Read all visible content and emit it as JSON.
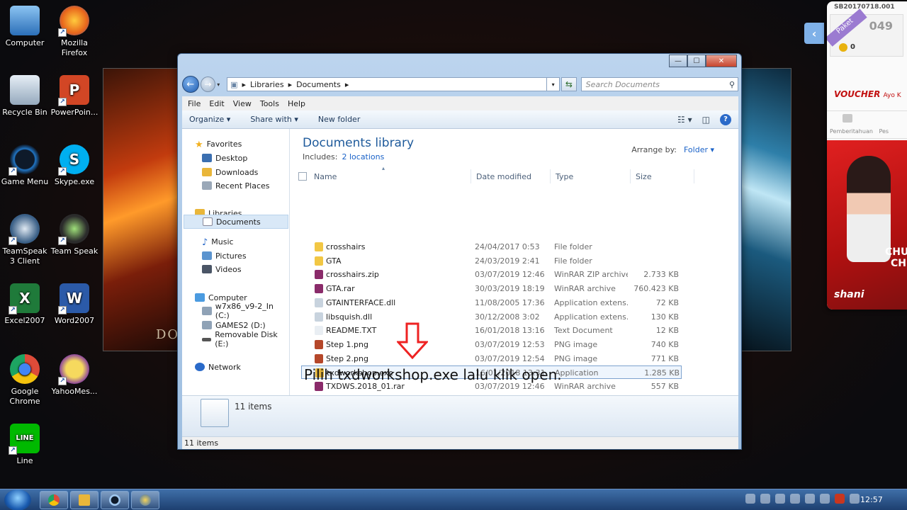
{
  "desktop": {
    "icons": [
      {
        "label": "Computer",
        "color": "#4b9be0"
      },
      {
        "label": "Mozilla Firefox",
        "color": "#e8661c"
      },
      {
        "label": "Recycle Bin",
        "color": "#9fb3c8"
      },
      {
        "label": "PowerPoin...",
        "color": "#d24625"
      },
      {
        "label": "Game Menu",
        "color": "#2176c6"
      },
      {
        "label": "Skype.exe",
        "color": "#00aff0"
      },
      {
        "label": "TeamSpeak 3 Client",
        "color": "#3a5f86"
      },
      {
        "label": "Team Speak",
        "color": "#2b2b2b"
      },
      {
        "label": "Excel2007",
        "color": "#1f7a3a"
      },
      {
        "label": "Word2007",
        "color": "#2b5aa8"
      },
      {
        "label": "Google Chrome",
        "color": "#dd4b39"
      },
      {
        "label": "YahooMes...",
        "color": "#7b2fa5"
      },
      {
        "label": "Line",
        "color": "#00b900"
      }
    ],
    "icon_glyphs": {
      "chrome": "●",
      "line": "LINE",
      "skype": "S",
      "excel": "X",
      "word": "W",
      "ppt": "P"
    },
    "wallpaper_text": "DO"
  },
  "window": {
    "address": {
      "root": "Libraries",
      "current": "Documents"
    },
    "search_placeholder": "Search Documents",
    "menu": [
      "File",
      "Edit",
      "View",
      "Tools",
      "Help"
    ],
    "toolbar": {
      "organize": "Organize ▾",
      "share": "Share with ▾",
      "new_folder": "New folder"
    },
    "nav": {
      "favorites": "Favorites",
      "desktop": "Desktop",
      "downloads": "Downloads",
      "recent": "Recent Places",
      "libraries": "Libraries",
      "documents": "Documents",
      "music": "Music",
      "pictures": "Pictures",
      "videos": "Videos",
      "computer": "Computer",
      "drive_c": "w7x86_v9-2_In (C:)",
      "drive_d": "GAMES2 (D:)",
      "drive_e": "Removable Disk (E:)",
      "network": "Network"
    },
    "library": {
      "title": "Documents library",
      "includes_label": "Includes:",
      "includes_link": "2 locations",
      "arrange_label": "Arrange by:",
      "arrange_value": "Folder ▾"
    },
    "columns": {
      "name": "Name",
      "date": "Date modified",
      "type": "Type",
      "size": "Size"
    },
    "files": [
      {
        "name": "crosshairs",
        "date": "24/04/2017 0:53",
        "type": "File folder",
        "size": "",
        "icon_color": "#f2c744"
      },
      {
        "name": "GTA",
        "date": "24/03/2019 2:41",
        "type": "File folder",
        "size": "",
        "icon_color": "#f2c744"
      },
      {
        "name": "crosshairs.zip",
        "date": "03/07/2019 12:46",
        "type": "WinRAR ZIP archive",
        "size": "2.733 KB",
        "icon_color": "#8a2b6a"
      },
      {
        "name": "GTA.rar",
        "date": "30/03/2019 18:19",
        "type": "WinRAR archive",
        "size": "760.423 KB",
        "icon_color": "#8a2b6a"
      },
      {
        "name": "GTAINTERFACE.dll",
        "date": "11/08/2005 17:36",
        "type": "Application extens...",
        "size": "72 KB",
        "icon_color": "#c8d3de"
      },
      {
        "name": "libsquish.dll",
        "date": "30/12/2008 3:02",
        "type": "Application extens...",
        "size": "130 KB",
        "icon_color": "#c8d3de"
      },
      {
        "name": "README.TXT",
        "date": "16/01/2018 13:16",
        "type": "Text Document",
        "size": "12 KB",
        "icon_color": "#e9eef3"
      },
      {
        "name": "Step 1.png",
        "date": "03/07/2019 12:53",
        "type": "PNG image",
        "size": "740 KB",
        "icon_color": "#b5472a"
      },
      {
        "name": "Step 2.png",
        "date": "03/07/2019 12:54",
        "type": "PNG image",
        "size": "771 KB",
        "icon_color": "#b5472a"
      },
      {
        "name": "txdworkshop.exe",
        "date": "16/01/2018 13:31",
        "type": "Application",
        "size": "1.285 KB",
        "icon_color": "#e0b23a"
      },
      {
        "name": "TXDWS.2018_01.rar",
        "date": "03/07/2019 12:46",
        "type": "WinRAR archive",
        "size": "557 KB",
        "icon_color": "#8a2b6a"
      }
    ],
    "details_count": "11 items",
    "status": "11 items"
  },
  "annotation": "Pilih txdworkshop.exe lalu klik open.",
  "ad": {
    "code": "SB20170718.001",
    "ribbon": "Paket",
    "balance": "049",
    "coins": "0",
    "brand": "VOUCHER",
    "brand_tail": "Ayo K",
    "notice": "Pemberitahuan",
    "notice_tail": "Pes",
    "banner_text": "CHU",
    "banner_text2": "CH",
    "banner_name": "shani"
  },
  "taskbar": {
    "clock": "12:57"
  }
}
